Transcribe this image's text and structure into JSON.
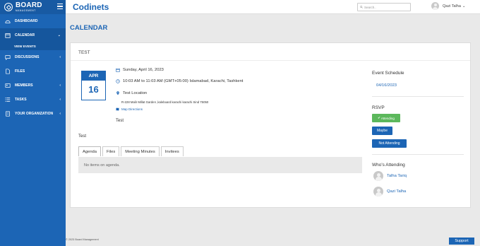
{
  "brand": {
    "title": "BOARD",
    "subtitle": "MANAGEMENT"
  },
  "app_title": "Codinets",
  "search": {
    "placeholder": "Search.."
  },
  "user": {
    "name": "Qazi Talha"
  },
  "nav": {
    "items": [
      {
        "label": "DASHBOARD"
      },
      {
        "label": "CALENDAR"
      },
      {
        "label": "VIEW EVENTS"
      },
      {
        "label": "DISCUSSIONS"
      },
      {
        "label": "FILES"
      },
      {
        "label": "MEMBERS"
      },
      {
        "label": "TASKS"
      },
      {
        "label": "YOUR ORGANIZATION"
      }
    ]
  },
  "page": {
    "title": "CALENDAR"
  },
  "event": {
    "title": "TEST",
    "month": "APR",
    "day": "16",
    "date_text": "Sunday, April 16, 2023",
    "time_text": "10:03 AM to 11:03 AM  (GMT+05:00) Islamabad, Karachi, Tashkent",
    "location": "Test Location",
    "address": "R-228 Malir Millat Garden ,kaleboard karachi karachi Sind 75050",
    "map_link": "Map Directions",
    "description": "Test",
    "section_label": "Test"
  },
  "tabs": [
    {
      "label": "Agenda"
    },
    {
      "label": "Files"
    },
    {
      "label": "Meeting Minutes"
    },
    {
      "label": "Invitees"
    }
  ],
  "agenda_empty": "No items on agenda.",
  "schedule": {
    "heading": "Event Schedule",
    "date": "04/16/2023"
  },
  "rsvp": {
    "heading": "RSVP",
    "attending": "Attending",
    "maybe": "Maybe",
    "not_attending": "Not Attending"
  },
  "whos_attending": {
    "heading": "Who's Attending",
    "people": [
      {
        "name": "Talha Tariq"
      },
      {
        "name": "Qazi Talha"
      }
    ]
  },
  "footer": {
    "copyright": "© 2023 Board Management",
    "support": "Support"
  },
  "colors": {
    "primary": "#1c65b5",
    "success": "#5cb85c",
    "background": "#e9e9e9"
  }
}
